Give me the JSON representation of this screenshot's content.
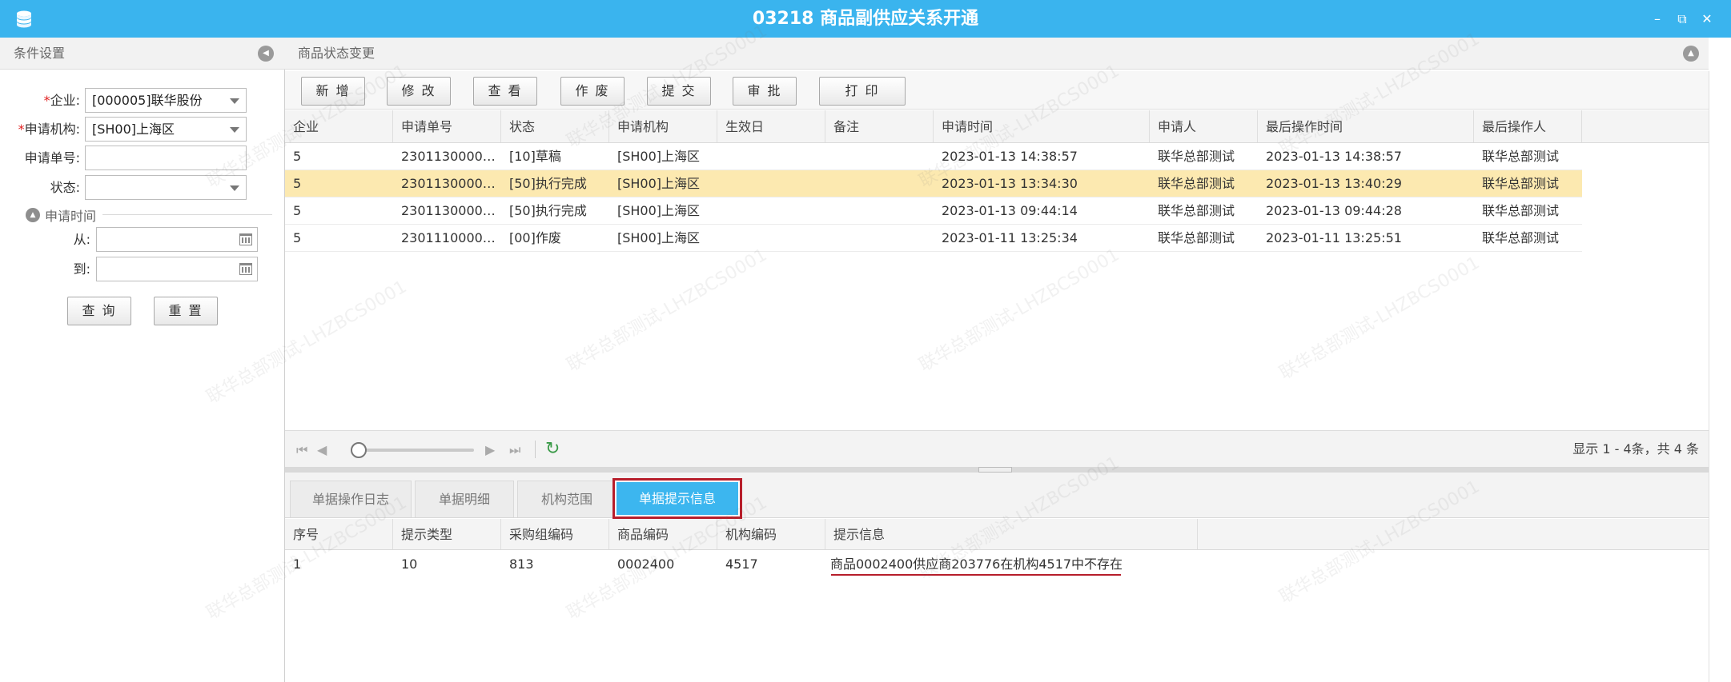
{
  "window": {
    "title": "03218 商品副供应关系开通",
    "minimize": "–",
    "restore": "⧉",
    "close": "✕"
  },
  "left_panel": {
    "title": "条件设置",
    "fields": {
      "company_label": "企业:",
      "company_value": "[000005]联华股份",
      "org_label": "申请机构:",
      "org_value": "[SH00]上海区",
      "apply_no_label": "申请单号:",
      "apply_no_value": "",
      "status_label": "状态:",
      "status_value": "",
      "apply_time_section": "申请时间",
      "from_label": "从:",
      "from_value": "",
      "to_label": "到:",
      "to_value": ""
    },
    "required_mark": "*",
    "query_button": "查 询",
    "reset_button": "重 置"
  },
  "main_panel": {
    "title": "商品状态变更",
    "toolbar": [
      "新 增",
      "修 改",
      "查 看",
      "作 废",
      "提 交",
      "审 批",
      "打 印"
    ],
    "columns": [
      "企业",
      "申请单号",
      "状态",
      "申请机构",
      "生效日",
      "备注",
      "申请时间",
      "申请人",
      "最后操作时间",
      "最后操作人"
    ],
    "rows": [
      [
        "5",
        "23011300000...",
        "[10]草稿",
        "[SH00]上海区",
        "",
        "",
        "2023-01-13 14:38:57",
        "联华总部测试",
        "2023-01-13 14:38:57",
        "联华总部测试"
      ],
      [
        "5",
        "23011300000...",
        "[50]执行完成",
        "[SH00]上海区",
        "",
        "",
        "2023-01-13 13:34:30",
        "联华总部测试",
        "2023-01-13 13:40:29",
        "联华总部测试"
      ],
      [
        "5",
        "23011300000...",
        "[50]执行完成",
        "[SH00]上海区",
        "",
        "",
        "2023-01-13 09:44:14",
        "联华总部测试",
        "2023-01-13 09:44:28",
        "联华总部测试"
      ],
      [
        "5",
        "23011100000...",
        "[00]作废",
        "[SH00]上海区",
        "",
        "",
        "2023-01-11 13:25:34",
        "联华总部测试",
        "2023-01-11 13:25:51",
        "联华总部测试"
      ]
    ],
    "selected_row": 1,
    "pager": {
      "summary": "显示 1 - 4条，共 4 条",
      "first": "⏮",
      "prev": "◀",
      "next": "▶",
      "last": "⏭",
      "refresh": "↻"
    }
  },
  "detail": {
    "tabs": [
      "单据操作日志",
      "单据明细",
      "机构范围",
      "单据提示信息"
    ],
    "active_tab": 3,
    "columns": [
      "序号",
      "提示类型",
      "采购组编码",
      "商品编码",
      "机构编码",
      "提示信息"
    ],
    "rows": [
      [
        "1",
        "10",
        "813",
        "0002400",
        "4517",
        "商品0002400供应商203776在机构4517中不存在"
      ]
    ]
  },
  "watermark": "联华总部测试-LHZBCS0001",
  "colors": {
    "titlebar": "#3ab4ee",
    "active_tab": "#3cb6ef",
    "selected_row": "#fce9b0",
    "highlight_border": "#b71e2b"
  }
}
